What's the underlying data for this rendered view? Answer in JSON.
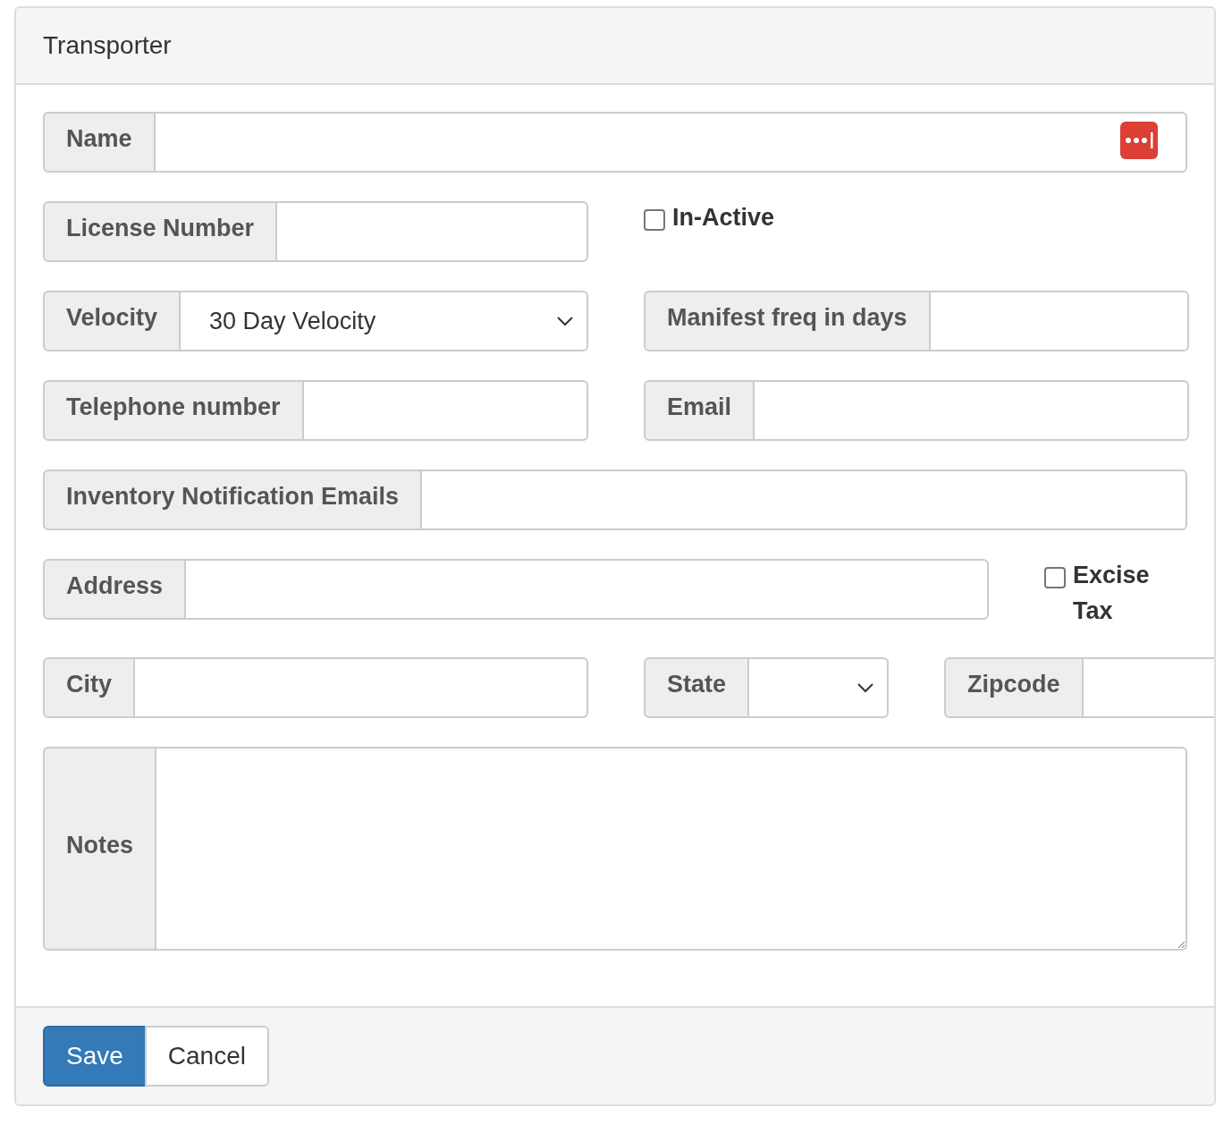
{
  "panel": {
    "title": "Transporter"
  },
  "rows": [
    {
      "items": [
        {
          "kind": "input",
          "label": "Name",
          "autofill_icon": true
        }
      ]
    },
    {
      "items": [
        {
          "kind": "input",
          "label": "License Number"
        },
        {
          "kind": "checkbox",
          "label": "In-Active",
          "checked": false
        }
      ]
    },
    {
      "items": [
        {
          "kind": "select",
          "label": "Velocity",
          "value": "30 Day Velocity"
        },
        {
          "kind": "input",
          "label": "Manifest freq in days"
        }
      ]
    },
    {
      "items": [
        {
          "kind": "input",
          "label": "Telephone number"
        },
        {
          "kind": "input",
          "label": "Email"
        }
      ]
    },
    {
      "items": [
        {
          "kind": "input",
          "label": "Inventory Notification Emails"
        }
      ]
    },
    {
      "items": [
        {
          "kind": "input",
          "label": "Address"
        },
        {
          "kind": "checkbox",
          "label": "Excise Tax",
          "checked": false
        }
      ]
    },
    {
      "items": [
        {
          "kind": "input",
          "label": "City"
        },
        {
          "kind": "select",
          "label": "State"
        },
        {
          "kind": "input",
          "label": "Zipcode"
        }
      ]
    },
    {
      "items": [
        {
          "kind": "textarea",
          "label": "Notes"
        }
      ]
    }
  ],
  "buttons": [
    {
      "label": "Save",
      "kind": "primary"
    },
    {
      "label": "Cancel",
      "kind": "default"
    }
  ]
}
